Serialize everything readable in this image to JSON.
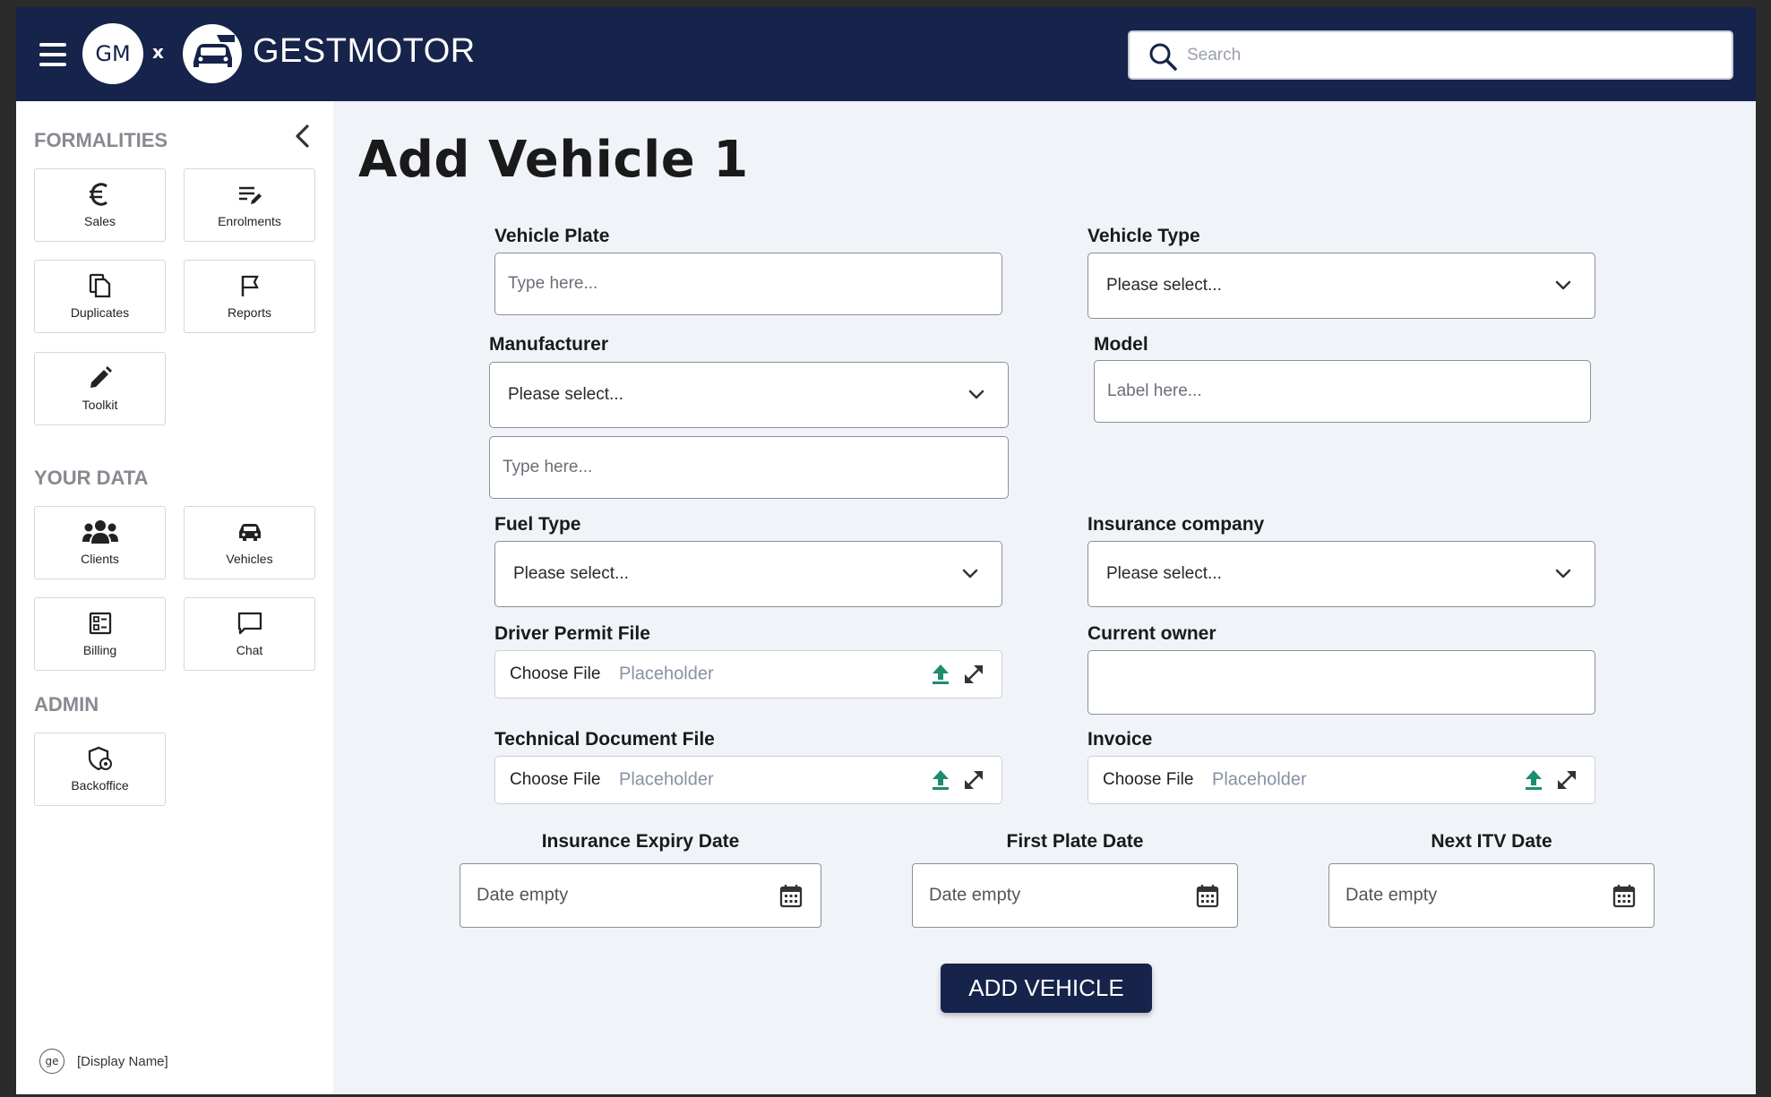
{
  "header": {
    "partner_badge": "GM",
    "times": "x",
    "brand": "GESTMOTOR",
    "search_placeholder": "Search"
  },
  "sidebar": {
    "formalities_title": "FORMALITIES",
    "formalities": [
      {
        "label": "Sales",
        "icon": "euro-icon"
      },
      {
        "label": "Enrolments",
        "icon": "edit-list-icon"
      },
      {
        "label": "Duplicates",
        "icon": "copy-icon"
      },
      {
        "label": "Reports",
        "icon": "flag-icon"
      },
      {
        "label": "Toolkit",
        "icon": "pencil-icon"
      }
    ],
    "your_data_title": "YOUR DATA",
    "your_data": [
      {
        "label": "Clients",
        "icon": "users-icon"
      },
      {
        "label": "Vehicles",
        "icon": "car-icon"
      },
      {
        "label": "Billing",
        "icon": "billing-icon"
      },
      {
        "label": "Chat",
        "icon": "chat-icon"
      }
    ],
    "admin_title": "ADMIN",
    "admin": [
      {
        "label": "Backoffice",
        "icon": "shield-gear-icon"
      }
    ],
    "user": {
      "avatar": "ge",
      "name": "[Display Name]"
    }
  },
  "main": {
    "title": "Add Vehicle 1",
    "vehicle_plate": {
      "label": "Vehicle Plate",
      "placeholder": "Type here..."
    },
    "vehicle_type": {
      "label": "Vehicle Type",
      "value": "Please select..."
    },
    "manufacturer": {
      "label": "Manufacturer",
      "value": "Please select...",
      "other_placeholder": "Type here..."
    },
    "model": {
      "label": "Model",
      "placeholder": "Label here..."
    },
    "fuel_type": {
      "label": "Fuel Type",
      "value": "Please select..."
    },
    "insurance_company": {
      "label": "Insurance company",
      "value": "Please select..."
    },
    "driver_permit_file": {
      "label": "Driver Permit File",
      "button": "Choose File",
      "placeholder": "Placeholder"
    },
    "current_owner": {
      "label": "Current owner",
      "value": ""
    },
    "technical_document_file": {
      "label": "Technical Document File",
      "button": "Choose File",
      "placeholder": "Placeholder"
    },
    "invoice": {
      "label": "Invoice",
      "button": "Choose File",
      "placeholder": "Placeholder"
    },
    "insurance_expiry_date": {
      "label": "Insurance Expiry Date",
      "value": "Date empty"
    },
    "first_plate_date": {
      "label": "First Plate Date",
      "value": "Date empty"
    },
    "next_itv_date": {
      "label": "Next ITV Date",
      "value": "Date empty"
    },
    "submit_label": "ADD VEHICLE"
  },
  "colors": {
    "navy": "#16234a",
    "upload_green": "#1e8c6e",
    "background": "#f0f3f8"
  }
}
